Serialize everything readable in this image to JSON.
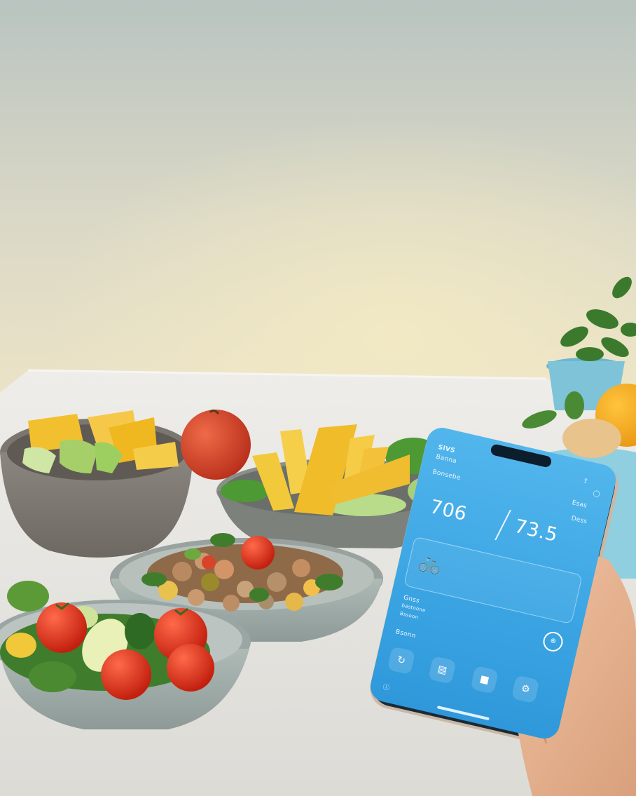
{
  "scene": {
    "description_colors": {
      "wall_top": "#c4cdc8",
      "wall_glow": "#e8e2c2",
      "table": "#e7e6e2",
      "screen_blue": "#3aa4e3"
    }
  },
  "phone": {
    "header_left_1": "SIVS",
    "header_left_2": "Banna",
    "row2_left": "Bonsebe",
    "row2_right": "Esas",
    "row3_right": "Dess",
    "value_left": "706",
    "value_right": "73.5",
    "card_icon": "bicycle-icon",
    "list_1": "Gnss",
    "list_2": "bastoone",
    "list_3": "Bssoon",
    "footer_label": "Bsonn",
    "nav_icons": [
      "refresh-icon",
      "document-icon",
      "stop-icon",
      "settings-icon"
    ]
  }
}
